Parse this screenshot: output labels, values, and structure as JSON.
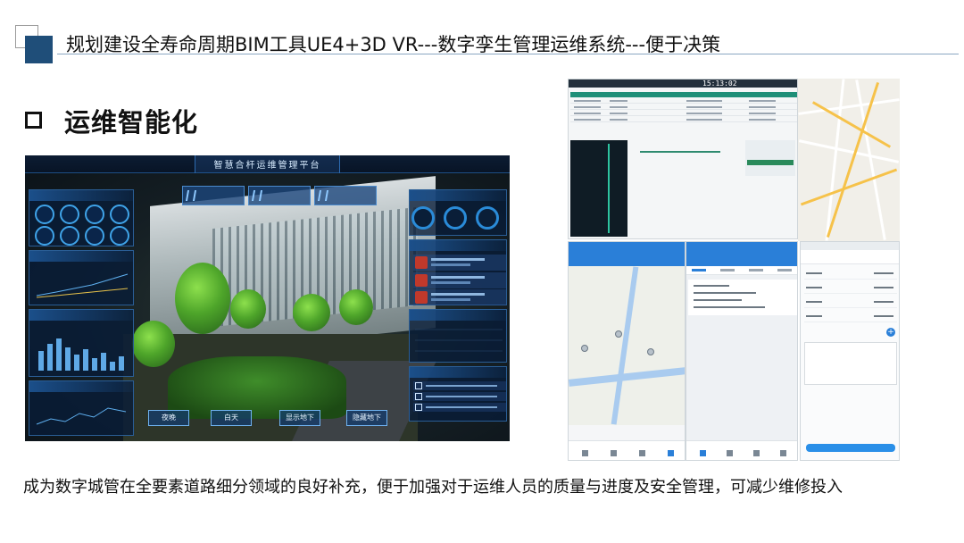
{
  "header": {
    "title": "规划建设全寿命周期BIM工具UE4+3D VR---数字孪生管理运维系统---便于决策"
  },
  "section": {
    "title": "运维智能化"
  },
  "footer": {
    "text": "成为数字城管在全要素道路细分领域的良好补充，便于加强对于运维人员的质量与进度及安全管理，可减少维修投入"
  },
  "dashboard": {
    "title": "智慧合杆运维管理平台",
    "buttons": [
      "夜晚",
      "白天",
      "显示地下",
      "隐藏地下"
    ]
  },
  "web_screenshot": {
    "clock": "15:13:02"
  },
  "colors": {
    "brand_blue": "#1f4e79",
    "dashboard_bg": "#151f24",
    "mobile_blue": "#2a7fd8",
    "table_green": "#1e8f78"
  }
}
